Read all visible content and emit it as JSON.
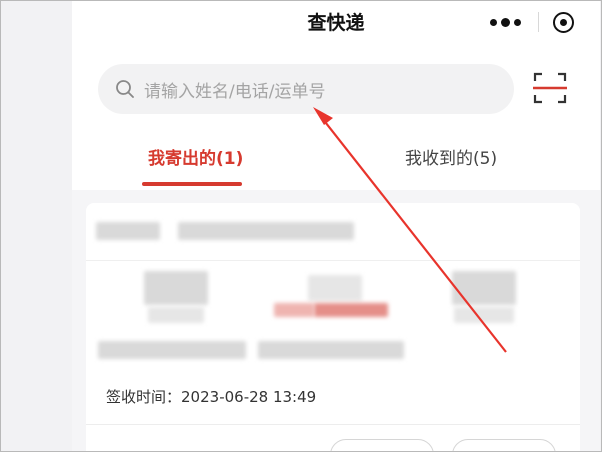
{
  "header": {
    "title": "查快递"
  },
  "search": {
    "placeholder": "请输入姓名/电话/运单号"
  },
  "tabs": [
    {
      "label": "我寄出的(1)",
      "active": true
    },
    {
      "label": "我收到的(5)",
      "active": false
    }
  ],
  "card": {
    "sign_time_label": "签收时间：",
    "sign_time_value": "2023-06-28 13:49"
  },
  "icons": {
    "search": "search-icon",
    "scan": "scan-icon",
    "more": "more-dots-icon",
    "close": "target-close-icon"
  },
  "colors": {
    "accent": "#d63a2f",
    "annotation_arrow": "#e8342c"
  }
}
